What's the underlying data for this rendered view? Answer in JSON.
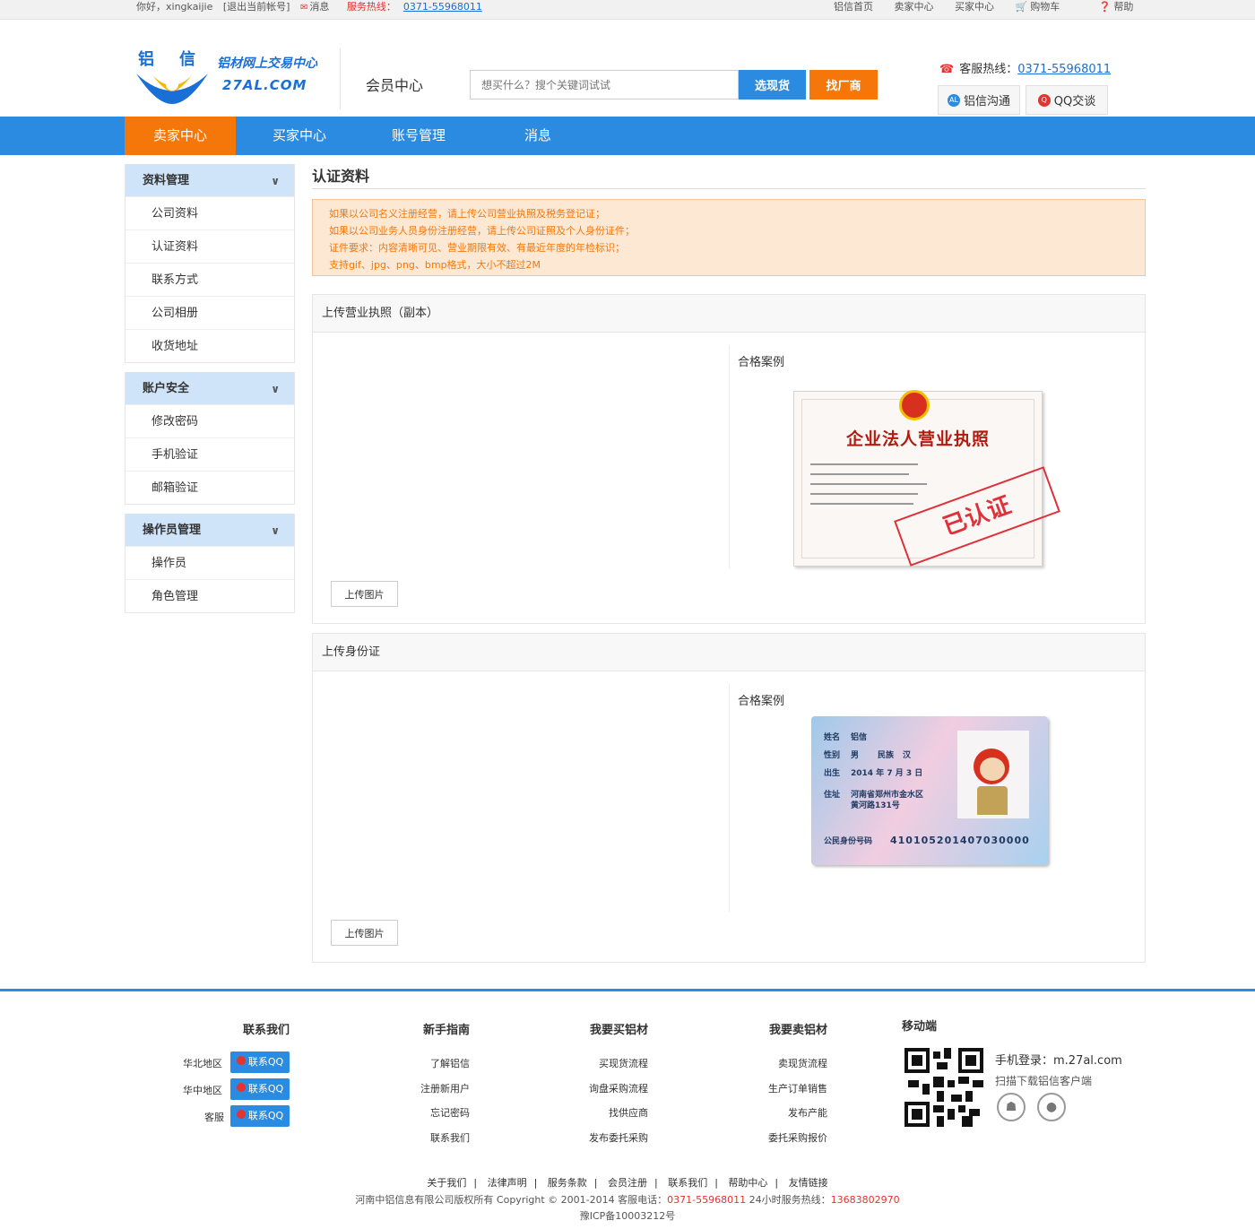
{
  "topbar": {
    "greeting": "你好，xingkaijie",
    "logout": "[退出当前帐号]",
    "messages": "消息",
    "hotline_label": "服务热线：",
    "hotline_number": "0371-55968011",
    "links": [
      "铝信首页",
      "卖家中心",
      "买家中心",
      "购物车",
      "帮助"
    ]
  },
  "header": {
    "logo_zh": "铝信",
    "logo_slogan": "铝材网上交易中心",
    "logo_domain": "27AL.COM",
    "member_center": "会员中心",
    "search_placeholder": "想买什么？搜个关键词试试",
    "btn_goods": "选现货",
    "btn_factory": "找厂商",
    "service_label": "客服热线：",
    "service_number": "0371-55968011",
    "chat_lx": "铝信沟通",
    "chat_qq": "QQ交谈"
  },
  "nav": {
    "items": [
      "卖家中心",
      "买家中心",
      "账号管理",
      "消息"
    ]
  },
  "sidebar": {
    "groups": [
      {
        "title": "资料管理",
        "items": [
          "公司资料",
          "认证资料",
          "联系方式",
          "公司相册",
          "收货地址"
        ]
      },
      {
        "title": "账户安全",
        "items": [
          "修改密码",
          "手机验证",
          "邮箱验证"
        ]
      },
      {
        "title": "操作员管理",
        "items": [
          "操作员",
          "角色管理"
        ]
      }
    ]
  },
  "content": {
    "title": "认证资料",
    "notice": [
      "如果以公司名义注册经营，请上传公司营业执照及税务登记证；",
      "如果以公司业务人员身份注册经营，请上传公司证照及个人身份证件；",
      "证件要求：内容清晰可见、营业期限有效、有最近年度的年检标识；",
      "支持gif、jpg、png、bmp格式，大小不超过2M"
    ],
    "panel_license": {
      "title": "上传营业执照（副本）",
      "sample": "合格案例",
      "upload": "上传图片",
      "license_title": "企业法人营业执照",
      "stamp": "已认证"
    },
    "panel_id": {
      "title": "上传身份证",
      "sample": "合格案例",
      "upload": "上传图片",
      "id_name_label": "姓名",
      "id_name": "铝信",
      "id_sex_label": "性别",
      "id_sex": "男",
      "id_nation_label": "民族",
      "id_nation": "汉",
      "id_birth_label": "出生",
      "id_birth": "2014 年 7 月 3 日",
      "id_addr_label": "住址",
      "id_addr1": "河南省郑州市金水区",
      "id_addr2": "黄河路131号",
      "id_num_label": "公民身份号码",
      "id_num": "410105201407030000"
    }
  },
  "footer": {
    "contact_title": "联系我们",
    "contact_rows": [
      "华北地区",
      "华中地区",
      "客服"
    ],
    "qq_label": "联系QQ",
    "guide_title": "新手指南",
    "guide_items": [
      "了解铝信",
      "注册新用户",
      "忘记密码",
      "联系我们"
    ],
    "buy_title": "我要买铝材",
    "buy_items": [
      "买现货流程",
      "询盘采购流程",
      "找供应商",
      "发布委托采购"
    ],
    "sell_title": "我要卖铝材",
    "sell_items": [
      "卖现货流程",
      "生产订单销售",
      "发布产能",
      "委托采购报价"
    ],
    "mobile_title": "移动端",
    "mobile_login": "手机登录：m.27al.com",
    "mobile_scan": "扫描下载铝信客户端",
    "links": [
      "关于我们",
      "法律声明",
      "服务条款",
      "会员注册",
      "联系我们",
      "帮助中心",
      "友情链接"
    ],
    "copyright_prefix": "河南中铝信息有限公司版权所有 Copyright © 2001-2014 客服电话：",
    "copyright_phone": "0371-55968011",
    "copyright_mid": " 24小时服务热线：",
    "copyright_hotline": "13683802970",
    "icp": "豫ICP备10003212号"
  }
}
